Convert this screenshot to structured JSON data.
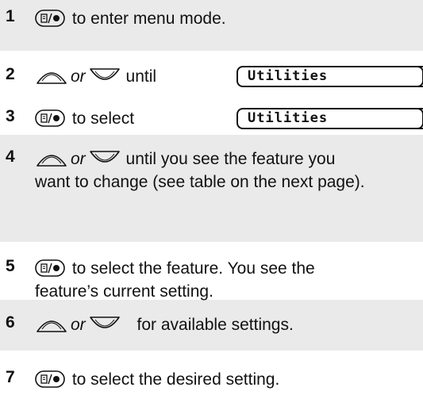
{
  "steps": [
    {
      "number": "1",
      "text": " to enter menu mode."
    },
    {
      "number": "2",
      "or_label": "or",
      "text": "until",
      "display": "Utilities"
    },
    {
      "number": "3",
      "text": " to select",
      "display": "Utilities"
    },
    {
      "number": "4",
      "or_label": "or",
      "text": "until you see the feature you",
      "text_cont": "want to change (see table on the next page)."
    },
    {
      "number": "5",
      "text": " to select the feature. You see the",
      "text_cont": "feature’s current setting."
    },
    {
      "number": "6",
      "or_label": "or",
      "text": "for available settings."
    },
    {
      "number": "7",
      "text": " to select the desired setting."
    }
  ],
  "icons": {
    "menu_select": "menu-select-button-icon",
    "scroll_up": "scroll-up-key-icon",
    "scroll_down": "scroll-down-key-icon"
  },
  "colors": {
    "shaded_band": "#eaeaea",
    "text": "#111111"
  }
}
